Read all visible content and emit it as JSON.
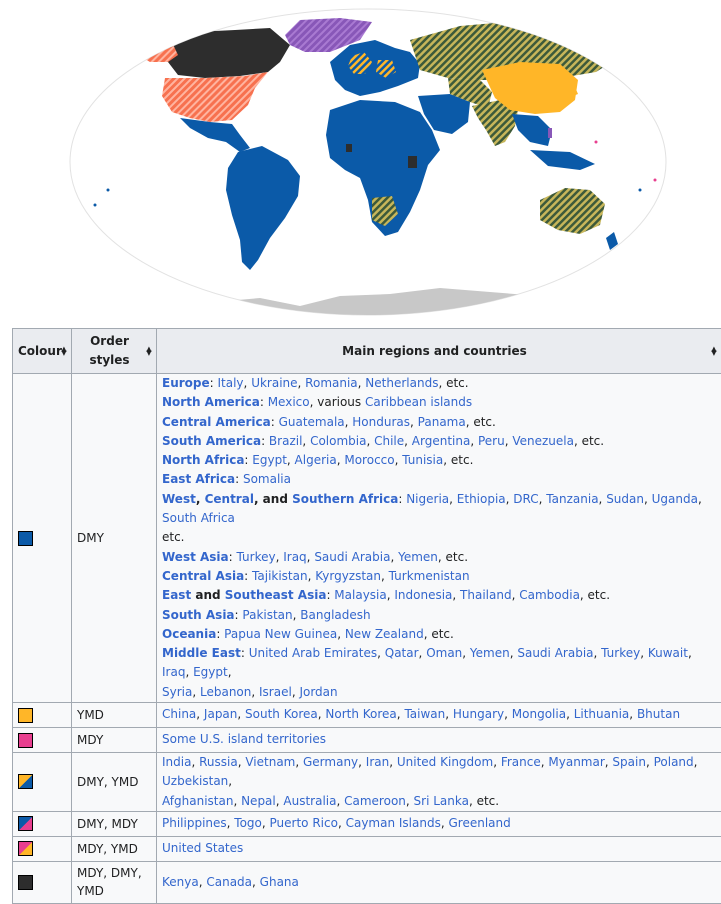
{
  "colors": {
    "dmy": "#0b5aa8",
    "ymd": "#ffb628",
    "mdy": "#e83f8f",
    "dmy_ymd_hatch": "#7c7f4a",
    "dmy_mdy": "#8857b8",
    "mdy_ymd": "#f7714f",
    "all_three": "#2d2d2d",
    "antarctica": "#c8c8c8",
    "link": "#3366cc"
  },
  "table": {
    "headers": [
      {
        "label": "Colour"
      },
      {
        "label": "Order styles"
      },
      {
        "label": "Main regions and countries"
      }
    ],
    "rows": [
      {
        "swatch": "dmy",
        "styles": "DMY",
        "lines": [
          [
            {
              "t": "Europe",
              "k": "label"
            },
            {
              "t": ": ",
              "k": "plain"
            },
            {
              "t": "Italy",
              "k": "link"
            },
            {
              "t": ", ",
              "k": "plain"
            },
            {
              "t": "Ukraine",
              "k": "link"
            },
            {
              "t": ", ",
              "k": "plain"
            },
            {
              "t": "Romania",
              "k": "link"
            },
            {
              "t": ", ",
              "k": "plain"
            },
            {
              "t": "Netherlands",
              "k": "link"
            },
            {
              "t": ", etc.",
              "k": "plain"
            }
          ],
          [
            {
              "t": "North America",
              "k": "label"
            },
            {
              "t": ": ",
              "k": "plain"
            },
            {
              "t": "Mexico",
              "k": "link"
            },
            {
              "t": ", various ",
              "k": "plain"
            },
            {
              "t": "Caribbean islands",
              "k": "link"
            }
          ],
          [
            {
              "t": "Central America",
              "k": "label"
            },
            {
              "t": ": ",
              "k": "plain"
            },
            {
              "t": "Guatemala",
              "k": "link"
            },
            {
              "t": ", ",
              "k": "plain"
            },
            {
              "t": "Honduras",
              "k": "link"
            },
            {
              "t": ", ",
              "k": "plain"
            },
            {
              "t": "Panama",
              "k": "link"
            },
            {
              "t": ", etc.",
              "k": "plain"
            }
          ],
          [
            {
              "t": "South America",
              "k": "label"
            },
            {
              "t": ": ",
              "k": "plain"
            },
            {
              "t": "Brazil",
              "k": "link"
            },
            {
              "t": ", ",
              "k": "plain"
            },
            {
              "t": "Colombia",
              "k": "link"
            },
            {
              "t": ", ",
              "k": "plain"
            },
            {
              "t": "Chile",
              "k": "link"
            },
            {
              "t": ", ",
              "k": "plain"
            },
            {
              "t": "Argentina",
              "k": "link"
            },
            {
              "t": ", ",
              "k": "plain"
            },
            {
              "t": "Peru",
              "k": "link"
            },
            {
              "t": ", ",
              "k": "plain"
            },
            {
              "t": "Venezuela",
              "k": "link"
            },
            {
              "t": ", etc.",
              "k": "plain"
            }
          ],
          [
            {
              "t": "North Africa",
              "k": "label"
            },
            {
              "t": ": ",
              "k": "plain"
            },
            {
              "t": "Egypt",
              "k": "link"
            },
            {
              "t": ", ",
              "k": "plain"
            },
            {
              "t": "Algeria",
              "k": "link"
            },
            {
              "t": ", ",
              "k": "plain"
            },
            {
              "t": "Morocco",
              "k": "link"
            },
            {
              "t": ", ",
              "k": "plain"
            },
            {
              "t": "Tunisia",
              "k": "link"
            },
            {
              "t": ", etc.",
              "k": "plain"
            }
          ],
          [
            {
              "t": "East Africa",
              "k": "label"
            },
            {
              "t": ": ",
              "k": "plain"
            },
            {
              "t": "Somalia",
              "k": "link"
            }
          ],
          [
            {
              "t": "West",
              "k": "label"
            },
            {
              "t": ", ",
              "k": "plain-b"
            },
            {
              "t": "Central",
              "k": "label"
            },
            {
              "t": ", and ",
              "k": "plain-b"
            },
            {
              "t": "Southern Africa",
              "k": "label"
            },
            {
              "t": ": ",
              "k": "plain"
            },
            {
              "t": "Nigeria",
              "k": "link"
            },
            {
              "t": ", ",
              "k": "plain"
            },
            {
              "t": "Ethiopia",
              "k": "link"
            },
            {
              "t": ", ",
              "k": "plain"
            },
            {
              "t": "DRC",
              "k": "link"
            },
            {
              "t": ", ",
              "k": "plain"
            },
            {
              "t": "Tanzania",
              "k": "link"
            },
            {
              "t": ", ",
              "k": "plain"
            },
            {
              "t": "Sudan",
              "k": "link"
            },
            {
              "t": ", ",
              "k": "plain"
            },
            {
              "t": "Uganda",
              "k": "link"
            },
            {
              "t": ", ",
              "k": "plain"
            },
            {
              "t": "South Africa",
              "k": "link"
            }
          ],
          [
            {
              "t": "etc.",
              "k": "plain"
            }
          ],
          [
            {
              "t": "West Asia",
              "k": "label"
            },
            {
              "t": ": ",
              "k": "plain"
            },
            {
              "t": "Turkey",
              "k": "link"
            },
            {
              "t": ", ",
              "k": "plain"
            },
            {
              "t": "Iraq",
              "k": "link"
            },
            {
              "t": ", ",
              "k": "plain"
            },
            {
              "t": "Saudi Arabia",
              "k": "link"
            },
            {
              "t": ", ",
              "k": "plain"
            },
            {
              "t": "Yemen",
              "k": "link"
            },
            {
              "t": ", etc.",
              "k": "plain"
            }
          ],
          [
            {
              "t": "Central Asia",
              "k": "label"
            },
            {
              "t": ": ",
              "k": "plain"
            },
            {
              "t": "Tajikistan",
              "k": "link"
            },
            {
              "t": ", ",
              "k": "plain"
            },
            {
              "t": "Kyrgyzstan",
              "k": "link"
            },
            {
              "t": ", ",
              "k": "plain"
            },
            {
              "t": "Turkmenistan",
              "k": "link"
            }
          ],
          [
            {
              "t": "East",
              "k": "label"
            },
            {
              "t": " and ",
              "k": "plain-b"
            },
            {
              "t": "Southeast Asia",
              "k": "label"
            },
            {
              "t": ": ",
              "k": "plain"
            },
            {
              "t": "Malaysia",
              "k": "link"
            },
            {
              "t": ", ",
              "k": "plain"
            },
            {
              "t": "Indonesia",
              "k": "link"
            },
            {
              "t": ", ",
              "k": "plain"
            },
            {
              "t": "Thailand",
              "k": "link"
            },
            {
              "t": ", ",
              "k": "plain"
            },
            {
              "t": "Cambodia",
              "k": "link"
            },
            {
              "t": ", etc.",
              "k": "plain"
            }
          ],
          [
            {
              "t": "South Asia",
              "k": "label"
            },
            {
              "t": ": ",
              "k": "plain"
            },
            {
              "t": "Pakistan",
              "k": "link"
            },
            {
              "t": ", ",
              "k": "plain"
            },
            {
              "t": "Bangladesh",
              "k": "link"
            }
          ],
          [
            {
              "t": "Oceania",
              "k": "label"
            },
            {
              "t": ": ",
              "k": "plain"
            },
            {
              "t": "Papua New Guinea",
              "k": "link"
            },
            {
              "t": ", ",
              "k": "plain"
            },
            {
              "t": "New Zealand",
              "k": "link"
            },
            {
              "t": ", etc.",
              "k": "plain"
            }
          ],
          [
            {
              "t": "Middle East",
              "k": "label"
            },
            {
              "t": ": ",
              "k": "plain"
            },
            {
              "t": "United Arab Emirates",
              "k": "link"
            },
            {
              "t": ", ",
              "k": "plain"
            },
            {
              "t": "Qatar",
              "k": "link"
            },
            {
              "t": ", ",
              "k": "plain"
            },
            {
              "t": "Oman",
              "k": "link"
            },
            {
              "t": ", ",
              "k": "plain"
            },
            {
              "t": "Yemen",
              "k": "link"
            },
            {
              "t": ", ",
              "k": "plain"
            },
            {
              "t": "Saudi Arabia",
              "k": "link"
            },
            {
              "t": ", ",
              "k": "plain"
            },
            {
              "t": "Turkey",
              "k": "link"
            },
            {
              "t": ", ",
              "k": "plain"
            },
            {
              "t": "Kuwait",
              "k": "link"
            },
            {
              "t": ", ",
              "k": "plain"
            },
            {
              "t": "Iraq",
              "k": "link"
            },
            {
              "t": ", ",
              "k": "plain"
            },
            {
              "t": "Egypt",
              "k": "link"
            },
            {
              "t": ",",
              "k": "plain"
            }
          ],
          [
            {
              "t": "Syria",
              "k": "link"
            },
            {
              "t": ", ",
              "k": "plain"
            },
            {
              "t": "Lebanon",
              "k": "link"
            },
            {
              "t": ", ",
              "k": "plain"
            },
            {
              "t": "Israel",
              "k": "link"
            },
            {
              "t": ", ",
              "k": "plain"
            },
            {
              "t": "Jordan",
              "k": "link"
            }
          ]
        ]
      },
      {
        "swatch": "ymd",
        "styles": "YMD",
        "lines": [
          [
            {
              "t": "China",
              "k": "link"
            },
            {
              "t": ", ",
              "k": "plain"
            },
            {
              "t": "Japan",
              "k": "link"
            },
            {
              "t": ", ",
              "k": "plain"
            },
            {
              "t": "South Korea",
              "k": "link"
            },
            {
              "t": ", ",
              "k": "plain"
            },
            {
              "t": "North Korea",
              "k": "link"
            },
            {
              "t": ", ",
              "k": "plain"
            },
            {
              "t": "Taiwan",
              "k": "link"
            },
            {
              "t": ", ",
              "k": "plain"
            },
            {
              "t": "Hungary",
              "k": "link"
            },
            {
              "t": ", ",
              "k": "plain"
            },
            {
              "t": "Mongolia",
              "k": "link"
            },
            {
              "t": ", ",
              "k": "plain"
            },
            {
              "t": "Lithuania",
              "k": "link"
            },
            {
              "t": ", ",
              "k": "plain"
            },
            {
              "t": "Bhutan",
              "k": "link"
            }
          ]
        ]
      },
      {
        "swatch": "mdy",
        "styles": "MDY",
        "lines": [
          [
            {
              "t": "Some U.S. island territories",
              "k": "link"
            }
          ]
        ]
      },
      {
        "swatch": "dmy_ymd",
        "styles": "DMY, YMD",
        "lines": [
          [
            {
              "t": "India",
              "k": "link"
            },
            {
              "t": ", ",
              "k": "plain"
            },
            {
              "t": "Russia",
              "k": "link"
            },
            {
              "t": ", ",
              "k": "plain"
            },
            {
              "t": "Vietnam",
              "k": "link"
            },
            {
              "t": ", ",
              "k": "plain"
            },
            {
              "t": "Germany",
              "k": "link"
            },
            {
              "t": ", ",
              "k": "plain"
            },
            {
              "t": "Iran",
              "k": "link"
            },
            {
              "t": ", ",
              "k": "plain"
            },
            {
              "t": "United Kingdom",
              "k": "link"
            },
            {
              "t": ", ",
              "k": "plain"
            },
            {
              "t": "France",
              "k": "link"
            },
            {
              "t": ", ",
              "k": "plain"
            },
            {
              "t": "Myanmar",
              "k": "link"
            },
            {
              "t": ", ",
              "k": "plain"
            },
            {
              "t": "Spain",
              "k": "link"
            },
            {
              "t": ", ",
              "k": "plain"
            },
            {
              "t": "Poland",
              "k": "link"
            },
            {
              "t": ", ",
              "k": "plain"
            },
            {
              "t": "Uzbekistan",
              "k": "link"
            },
            {
              "t": ",",
              "k": "plain"
            }
          ],
          [
            {
              "t": "Afghanistan",
              "k": "link"
            },
            {
              "t": ", ",
              "k": "plain"
            },
            {
              "t": "Nepal",
              "k": "link"
            },
            {
              "t": ", ",
              "k": "plain"
            },
            {
              "t": "Australia",
              "k": "link"
            },
            {
              "t": ", ",
              "k": "plain"
            },
            {
              "t": "Cameroon",
              "k": "link"
            },
            {
              "t": ", ",
              "k": "plain"
            },
            {
              "t": "Sri Lanka",
              "k": "link"
            },
            {
              "t": ", etc.",
              "k": "plain"
            }
          ]
        ]
      },
      {
        "swatch": "dmy_mdy",
        "styles": "DMY, MDY",
        "lines": [
          [
            {
              "t": "Philippines",
              "k": "link"
            },
            {
              "t": ", ",
              "k": "plain"
            },
            {
              "t": "Togo",
              "k": "link"
            },
            {
              "t": ", ",
              "k": "plain"
            },
            {
              "t": "Puerto Rico",
              "k": "link"
            },
            {
              "t": ", ",
              "k": "plain"
            },
            {
              "t": "Cayman Islands",
              "k": "link"
            },
            {
              "t": ", ",
              "k": "plain"
            },
            {
              "t": "Greenland",
              "k": "link"
            }
          ]
        ]
      },
      {
        "swatch": "mdy_ymd",
        "styles": "MDY, YMD",
        "lines": [
          [
            {
              "t": "United States",
              "k": "link"
            }
          ]
        ]
      },
      {
        "swatch": "all_three",
        "styles": "MDY, DMY, YMD",
        "lines": [
          [
            {
              "t": "Kenya",
              "k": "link"
            },
            {
              "t": ", ",
              "k": "plain"
            },
            {
              "t": "Canada",
              "k": "link"
            },
            {
              "t": ", ",
              "k": "plain"
            },
            {
              "t": "Ghana",
              "k": "link"
            }
          ]
        ]
      }
    ]
  }
}
